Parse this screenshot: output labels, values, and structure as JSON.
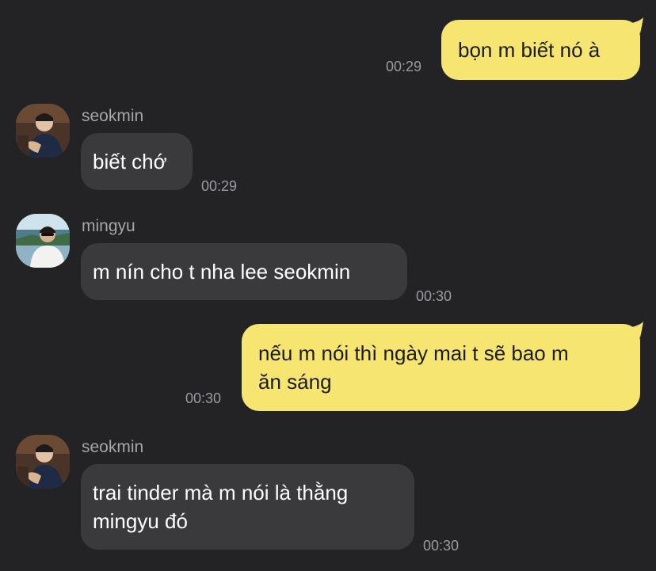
{
  "messages": [
    {
      "side": "out",
      "text": "bọn m biết nó à",
      "time": "00:29"
    },
    {
      "side": "in",
      "sender": "seokmin",
      "text": "biết chớ",
      "time": "00:29"
    },
    {
      "side": "in",
      "sender": "mingyu",
      "text": "m nín cho t nha lee seokmin",
      "time": "00:30"
    },
    {
      "side": "out",
      "text_lines": [
        "nếu m nói thì ngày mai t sẽ bao m",
        "ăn sáng"
      ],
      "time": "00:30"
    },
    {
      "side": "in",
      "sender": "seokmin",
      "text_lines": [
        "trai tinder mà m nói là thằng",
        "mingyu đó"
      ],
      "time": "00:30"
    }
  ],
  "colors": {
    "background": "#232325",
    "incoming_bubble": "#3a3a3c",
    "outgoing_bubble": "#f7e571"
  }
}
